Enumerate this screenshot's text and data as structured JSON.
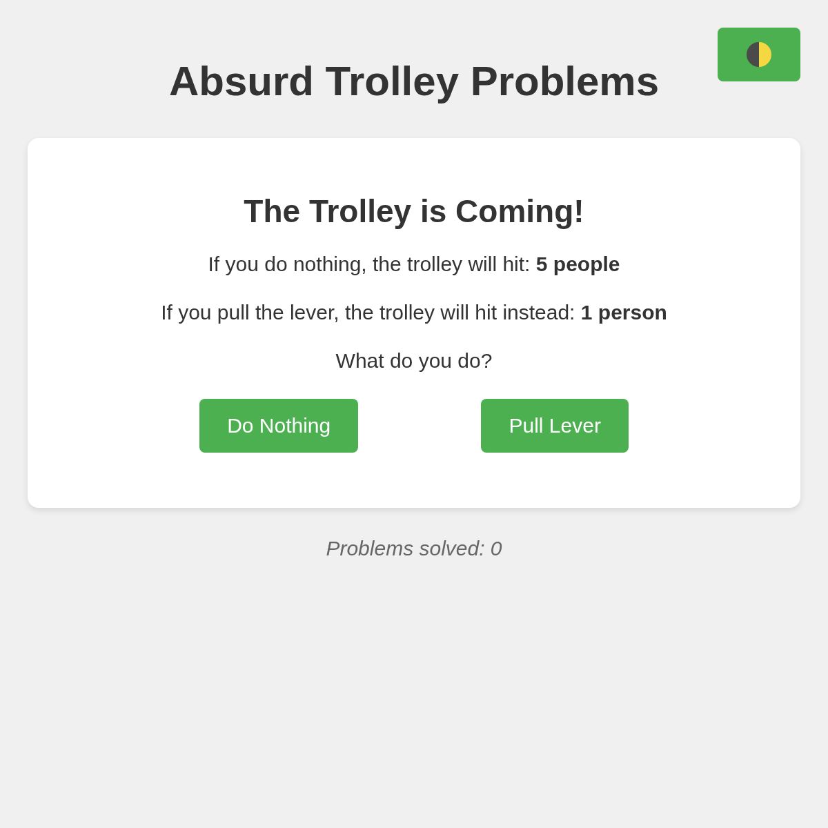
{
  "page_title": "Absurd Trolley Problems",
  "theme_button": {
    "kind": "icon"
  },
  "card": {
    "heading": "The Trolley is Coming!",
    "lines": [
      "If you do nothing, the trolley will hit: **5 people**",
      "If you pull the lever, the trolley will hit instead: **1 person**",
      "What do you do?"
    ],
    "buttons": [
      "Do Nothing",
      "Pull Lever"
    ]
  },
  "footer": "Problems solved: 0"
}
